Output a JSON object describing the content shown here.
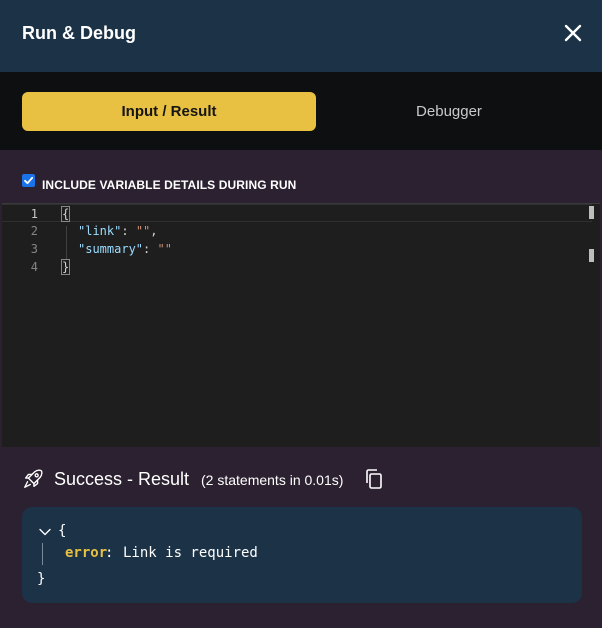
{
  "header": {
    "title": "Run & Debug",
    "close_icon": "close-icon"
  },
  "tabs": [
    {
      "label": "Input / Result",
      "active": true
    },
    {
      "label": "Debugger",
      "active": false
    }
  ],
  "options": {
    "include_variables_label": "INCLUDE VARIABLE DETAILS DURING RUN",
    "include_variables_checked": true
  },
  "editor": {
    "lines": [
      {
        "number": "1",
        "text": "{"
      },
      {
        "number": "2",
        "key": "\"link\"",
        "sep": ": ",
        "value": "\"\"",
        "trail": ","
      },
      {
        "number": "3",
        "key": "\"summary\"",
        "sep": ": ",
        "value": "\"\"",
        "trail": ""
      },
      {
        "number": "4",
        "text": "}"
      }
    ]
  },
  "result": {
    "icon": "rocket-icon",
    "title": "Success - Result",
    "meta": "(2 statements in 0.01s)",
    "copy_icon": "copy-icon",
    "open_brace": "{",
    "close_brace": "}",
    "key": "error",
    "colon": ":",
    "value": "Link is required"
  },
  "colors": {
    "header_bg": "#1b3247",
    "accent": "#e8c042",
    "panel_bg": "#2c2130",
    "editor_bg": "#1e1e1e"
  }
}
